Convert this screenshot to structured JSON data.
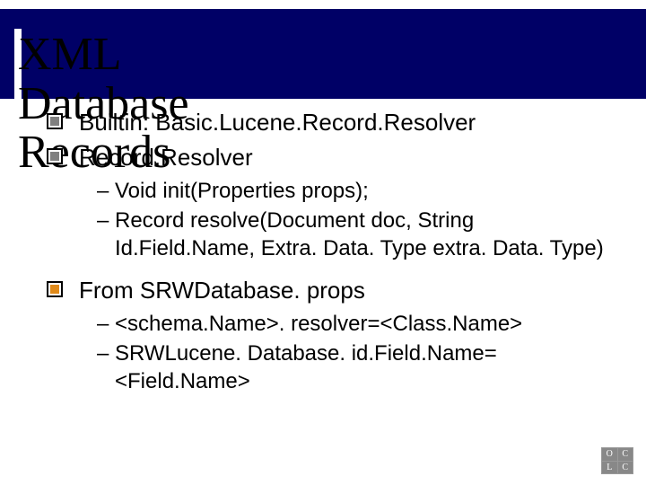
{
  "title": "XML Database Records",
  "bullets": [
    {
      "style": "gray",
      "text": "Builtin: Basic.Lucene.Record.Resolver"
    },
    {
      "style": "gray",
      "text": "Record.Resolver"
    },
    {
      "style": "orange",
      "text": "From SRWDatabase. props"
    }
  ],
  "sub1": [
    "Void init(Properties props);",
    "Record resolve(Document doc, String Id.Field.Name, Extra. Data. Type extra. Data. Type)"
  ],
  "sub2": [
    "<schema.Name>. resolver=<Class.Name>",
    "SRWLucene. Database. id.Field.Name= <Field.Name>"
  ],
  "logo": {
    "tl": "O",
    "tr": "C",
    "bl": "L",
    "br": "C"
  }
}
